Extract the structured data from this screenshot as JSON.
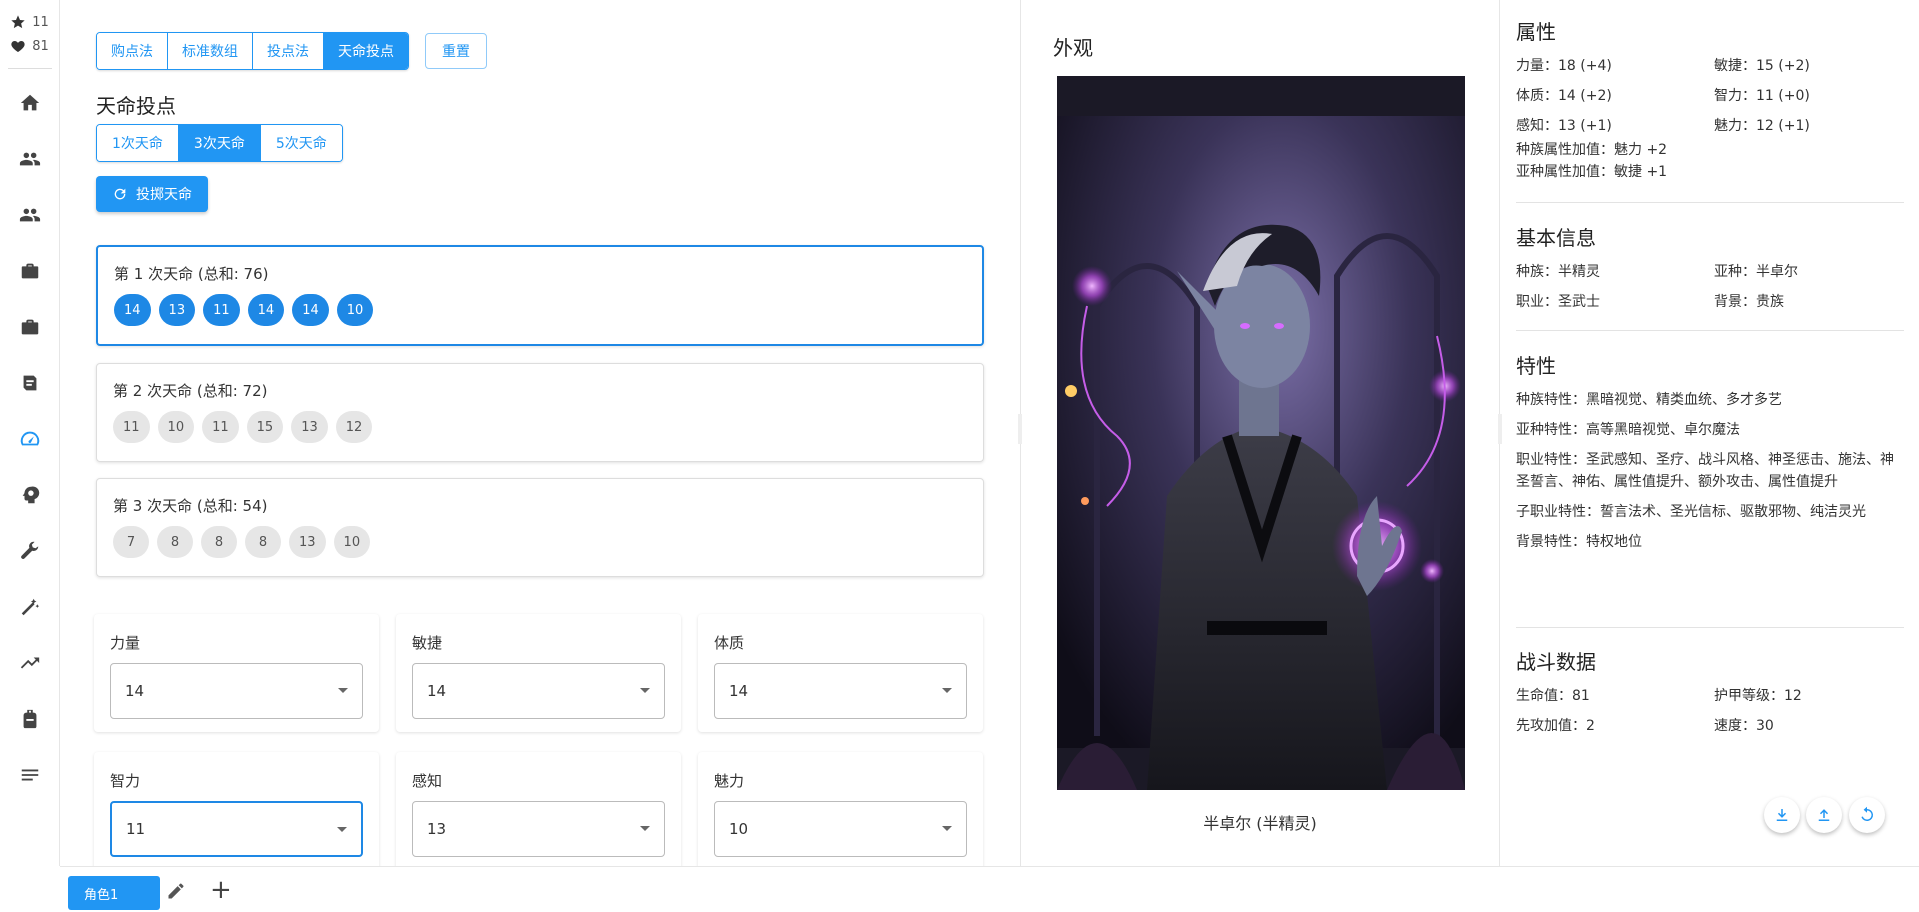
{
  "rail": {
    "stars": "11",
    "likes": "81",
    "nav": [
      "home-icon",
      "people-icon",
      "group-icon",
      "briefcase-icon",
      "work-icon",
      "scroll-icon",
      "speed-icon",
      "psychology-icon",
      "wrench-icon",
      "magic-wand-icon",
      "trending-icon",
      "backpack-icon",
      "list-icon"
    ],
    "active_index": 6
  },
  "methods": {
    "tabs": [
      "购点法",
      "标准数组",
      "投点法",
      "天命投点"
    ],
    "active": 3,
    "reset_label": "重置"
  },
  "fate_section": {
    "title": "天命投点",
    "times": [
      "1次天命",
      "3次天命",
      "5次天命"
    ],
    "active_time": 1,
    "roll_label": "投掷天命",
    "rolls": [
      {
        "title": "第 1 次天命 (总和: 76)",
        "values": [
          "14",
          "13",
          "11",
          "14",
          "14",
          "10"
        ]
      },
      {
        "title": "第 2 次天命 (总和: 72)",
        "values": [
          "11",
          "10",
          "11",
          "15",
          "13",
          "12"
        ]
      },
      {
        "title": "第 3 次天命 (总和: 54)",
        "values": [
          "7",
          "8",
          "8",
          "8",
          "13",
          "10"
        ]
      }
    ]
  },
  "abilities": [
    {
      "label": "力量",
      "value": "14"
    },
    {
      "label": "敏捷",
      "value": "14"
    },
    {
      "label": "体质",
      "value": "14"
    },
    {
      "label": "智力",
      "value": "11"
    },
    {
      "label": "感知",
      "value": "13"
    },
    {
      "label": "魅力",
      "value": "10"
    }
  ],
  "appearance": {
    "title": "外观",
    "caption": "半卓尔 (半精灵)"
  },
  "attributes": {
    "title": "属性",
    "str": "力量：18 (+4)",
    "dex": "敏捷：15 (+2)",
    "con": "体质：14 (+2)",
    "int": "智力：11 (+0)",
    "wis": "感知：13 (+1)",
    "cha": "魅力：12 (+1)",
    "race_bonus": "种族属性加值：魅力 +2",
    "subrace_bonus": "亚种属性加值：敏捷 +1"
  },
  "basic": {
    "title": "基本信息",
    "race": "种族：半精灵",
    "subrace": "亚种：半卓尔",
    "class": "职业：圣武士",
    "background": "背景：贵族"
  },
  "traits": {
    "title": "特性",
    "race": "种族特性：黑暗视觉、精类血统、多才多艺",
    "subrace": "亚种特性：高等黑暗视觉、卓尔魔法",
    "class": "职业特性：圣武感知、圣疗、战斗风格、神圣惩击、施法、神圣誓言、神佑、属性值提升、额外攻击、属性值提升",
    "subclass": "子职业特性：誓言法术、圣光信标、驱散邪物、纯洁灵光",
    "background": "背景特性：特权地位"
  },
  "combat": {
    "title": "战斗数据",
    "hp": "生命值：81",
    "ac": "护甲等级：12",
    "init": "先攻加值：2",
    "speed": "速度：30"
  },
  "bottom": {
    "tab_label": "角色1"
  }
}
